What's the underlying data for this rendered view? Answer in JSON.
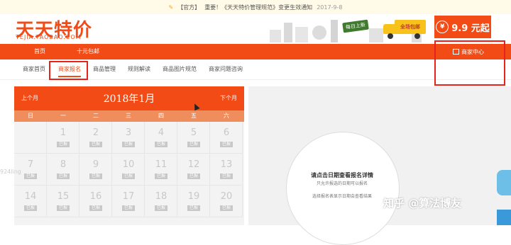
{
  "notice": {
    "tag": "【官方】",
    "headline": "重要！《天天特价管理规范》变更生效通知",
    "date": "2017-9-8"
  },
  "brand": {
    "logo_text": "天天特价",
    "logo_sub": "TEJIA.TAOBAO.COM",
    "daily_sign": "每日上新",
    "truck_label": "全场包邮",
    "price_badge": "9.9 元起",
    "yuan_symbol": "¥"
  },
  "nav": {
    "items": [
      "首页",
      "十元包邮"
    ],
    "merchant_center": "商家中心"
  },
  "subnav": {
    "tabs": [
      "商家首页",
      "商家报名",
      "商品管理",
      "规则解读",
      "商品图片规范",
      "商家问题咨询"
    ],
    "active_index": 1
  },
  "calendar": {
    "prev": "上个月",
    "next": "下个月",
    "title": "2018年1月",
    "weekdays": [
      "日",
      "一",
      "二",
      "三",
      "四",
      "五",
      "六"
    ],
    "weeks": [
      [
        "",
        "1",
        "2",
        "3",
        "4",
        "5",
        "6"
      ],
      [
        "7",
        "8",
        "9",
        "10",
        "11",
        "12",
        "13"
      ],
      [
        "14",
        "15",
        "16",
        "17",
        "18",
        "19",
        "20"
      ]
    ],
    "tag_label": "已报"
  },
  "panel": {
    "title": "请点击日期查看报名详情",
    "line2": "只允许报选的日期可以报名",
    "line3": "选择报名表显示日期会查看结果"
  },
  "watermark": {
    "text": "知乎 @算法博友",
    "left_mark": "924ling"
  },
  "colors": {
    "brand_orange": "#f24b16",
    "highlight_red": "#e8211b"
  }
}
